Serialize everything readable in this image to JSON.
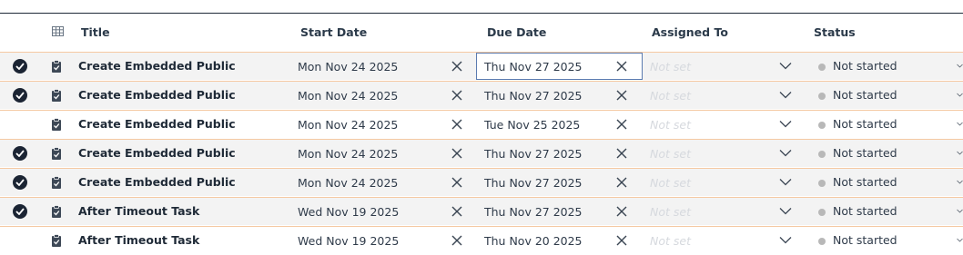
{
  "columns": {
    "title": "Title",
    "start_date": "Start Date",
    "due_date": "Due Date",
    "assigned_to": "Assigned To",
    "status": "Status"
  },
  "rows": [
    {
      "selected": true,
      "title": "Create Embedded Public",
      "start": "Mon Nov 24 2025",
      "due": "Thu Nov 27 2025",
      "assigned": "Not set",
      "status": "Not started",
      "focused_due": true
    },
    {
      "selected": true,
      "title": "Create Embedded Public",
      "start": "Mon Nov 24 2025",
      "due": "Thu Nov 27 2025",
      "assigned": "Not set",
      "status": "Not started"
    },
    {
      "selected": false,
      "title": "Create Embedded Public",
      "start": "Mon Nov 24 2025",
      "due": "Tue Nov 25 2025",
      "assigned": "Not set",
      "status": "Not started"
    },
    {
      "selected": true,
      "title": "Create Embedded Public",
      "start": "Mon Nov 24 2025",
      "due": "Thu Nov 27 2025",
      "assigned": "Not set",
      "status": "Not started"
    },
    {
      "selected": true,
      "title": "Create Embedded Public",
      "start": "Mon Nov 24 2025",
      "due": "Thu Nov 27 2025",
      "assigned": "Not set",
      "status": "Not started"
    },
    {
      "selected": true,
      "title": "After Timeout Task",
      "start": "Wed Nov 19 2025",
      "due": "Thu Nov 27 2025",
      "assigned": "Not set",
      "status": "Not started"
    },
    {
      "selected": false,
      "title": "After Timeout Task",
      "start": "Wed Nov 19 2025",
      "due": "Thu Nov 20 2025",
      "assigned": "Not set",
      "status": "Not started"
    }
  ],
  "icons": {
    "select_check": "check-circle-icon",
    "task_type": "clipboard-check-icon",
    "clear": "close-icon",
    "dropdown": "chevron-down-icon",
    "header_grid": "table-grid-icon"
  },
  "colors": {
    "row_border": "#f5c9a2",
    "selected_row": "#f3f3f3",
    "check_fill": "#1b2433",
    "status_dot": "#b8b8b8",
    "focus_border": "#5b7bb0"
  }
}
